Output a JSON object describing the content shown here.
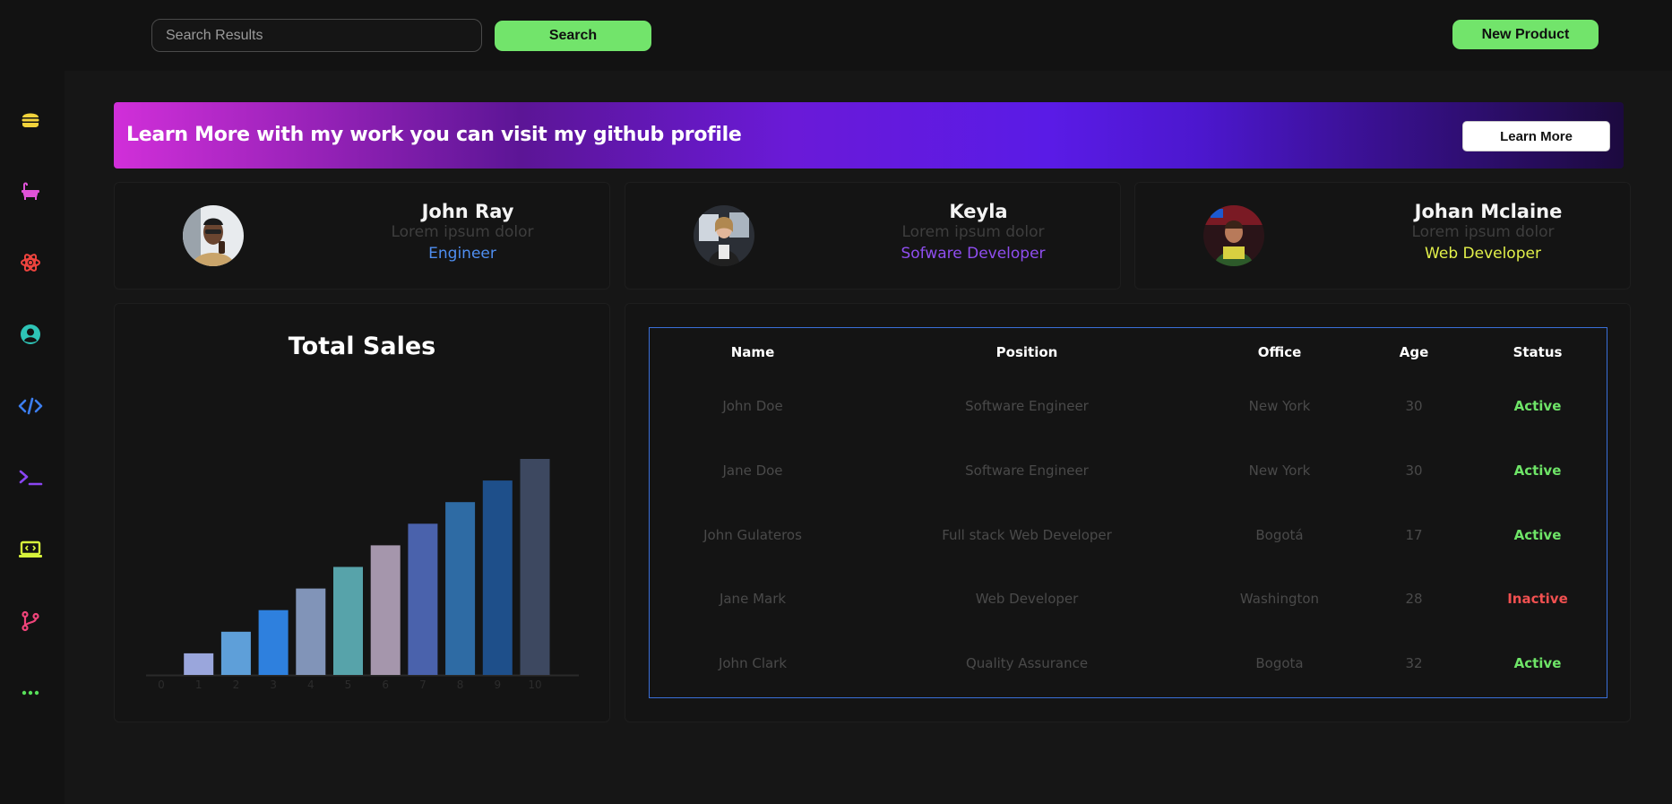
{
  "topbar": {
    "search_placeholder": "Search Results",
    "search_label": "Search",
    "new_product_label": "New Product"
  },
  "sidebar": {
    "icons": [
      {
        "name": "burger-icon",
        "color": "#f2d33b"
      },
      {
        "name": "bathtub-icon",
        "color": "#e052d8"
      },
      {
        "name": "react-atom-icon",
        "color": "#f0443e"
      },
      {
        "name": "user-circle-icon",
        "color": "#2ec4b6"
      },
      {
        "name": "code-icon",
        "color": "#3c7ef0"
      },
      {
        "name": "terminal-icon",
        "color": "#8a45f2"
      },
      {
        "name": "laptop-code-icon",
        "color": "#d7f23b"
      },
      {
        "name": "git-branch-icon",
        "color": "#f0447a"
      },
      {
        "name": "more-dots-icon",
        "color": "#58e05a"
      }
    ]
  },
  "banner": {
    "text": "Learn More with my work you can visit my github profile",
    "button_label": "Learn More"
  },
  "profiles": [
    {
      "name": "John Ray",
      "subtitle": "Lorem ipsum dolor",
      "role": "Engineer",
      "role_color": "#4f8ef0"
    },
    {
      "name": "Keyla",
      "subtitle": "Lorem ipsum dolor",
      "role": "Sofware Developer",
      "role_color": "#8f4ef0"
    },
    {
      "name": "Johan Mclaine",
      "subtitle": "Lorem ipsum dolor",
      "role": "Web Developer",
      "role_color": "#e2f04a"
    }
  ],
  "chart_data": {
    "type": "bar",
    "title": "Total Sales",
    "categories": [
      "1",
      "2",
      "3",
      "4",
      "5",
      "6",
      "7",
      "8",
      "9",
      "10"
    ],
    "x_ticks": [
      "0",
      "1",
      "2",
      "3",
      "4",
      "5",
      "6",
      "7",
      "8",
      "9",
      "10"
    ],
    "values": [
      1,
      2,
      3,
      4,
      5,
      6,
      7,
      8,
      9,
      10
    ],
    "colors": [
      "#9aa6dc",
      "#5e9fd9",
      "#2e80de",
      "#8194b8",
      "#57a3aa",
      "#a596ac",
      "#4a62ac",
      "#2e6ba4",
      "#1e4f8a",
      "#3d4860"
    ],
    "ylim": [
      0,
      10
    ],
    "grid": false,
    "legend": "none"
  },
  "table": {
    "headers": [
      "Name",
      "Position",
      "Office",
      "Age",
      "Status"
    ],
    "rows": [
      {
        "name": "John Doe",
        "position": "Software Engineer",
        "office": "New York",
        "age": "30",
        "status": "Active"
      },
      {
        "name": "Jane Doe",
        "position": "Software Engineer",
        "office": "New York",
        "age": "30",
        "status": "Active"
      },
      {
        "name": "John Gulateros",
        "position": "Full stack Web Developer",
        "office": "Bogotá",
        "age": "17",
        "status": "Active"
      },
      {
        "name": "Jane Mark",
        "position": "Web Developer",
        "office": "Washington",
        "age": "28",
        "status": "Inactive"
      },
      {
        "name": "John Clark",
        "position": "Quality Assurance",
        "office": "Bogota",
        "age": "32",
        "status": "Active"
      }
    ],
    "status_colors": {
      "Active": "#6ee467",
      "Inactive": "#f05050"
    },
    "border_color": "#3a6fd8"
  }
}
